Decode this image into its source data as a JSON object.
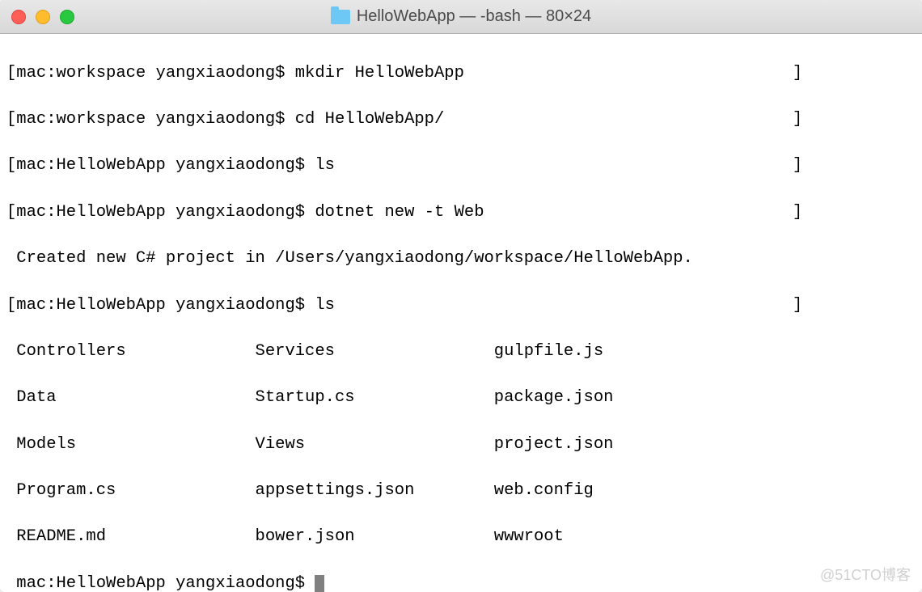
{
  "window": {
    "title": "HelloWebApp — -bash — 80×24"
  },
  "terminal": {
    "lines": [
      "[mac:workspace yangxiaodong$ mkdir HelloWebApp                                 ]",
      "[mac:workspace yangxiaodong$ cd HelloWebApp/                                   ]",
      "[mac:HelloWebApp yangxiaodong$ ls                                              ]",
      "[mac:HelloWebApp yangxiaodong$ dotnet new -t Web                               ]",
      " Created new C# project in /Users/yangxiaodong/workspace/HelloWebApp.",
      "[mac:HelloWebApp yangxiaodong$ ls                                              ]",
      " Controllers             Services                gulpfile.js",
      " Data                    Startup.cs              package.json",
      " Models                  Views                   project.json",
      " Program.cs              appsettings.json        web.config",
      " README.md               bower.json              wwwroot"
    ],
    "prompt": " mac:HelloWebApp yangxiaodong$ "
  },
  "watermark": "@51CTO博客"
}
